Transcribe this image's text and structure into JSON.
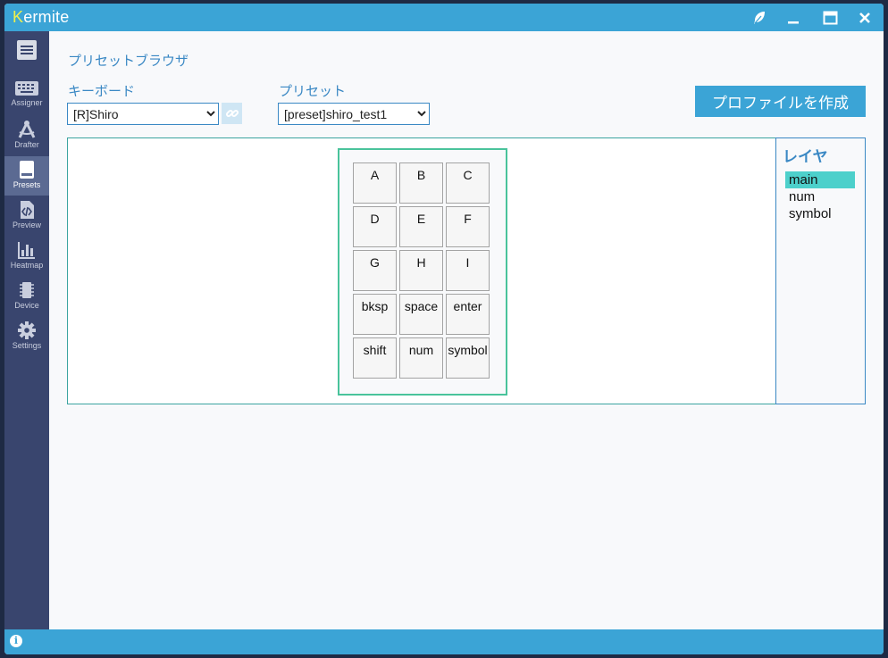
{
  "app": {
    "title_first": "K",
    "title_rest": "ermite"
  },
  "sidebar": {
    "items": [
      {
        "label": "Assigner",
        "icon": "keyboard-icon"
      },
      {
        "label": "Drafter",
        "icon": "compass-icon"
      },
      {
        "label": "Presets",
        "icon": "book-icon",
        "active": true
      },
      {
        "label": "Preview",
        "icon": "code-file-icon"
      },
      {
        "label": "Heatmap",
        "icon": "bar-chart-icon"
      },
      {
        "label": "Device",
        "icon": "chip-icon"
      },
      {
        "label": "Settings",
        "icon": "gear-icon"
      }
    ]
  },
  "page": {
    "title": "プリセットブラウザ",
    "keyboard_label": "キーボード",
    "keyboard_value": "[R]Shiro",
    "preset_label": "プリセット",
    "preset_value": "[preset]shiro_test1",
    "create_profile_button": "プロファイルを作成"
  },
  "keyboard": {
    "rows": [
      [
        "A",
        "B",
        "C"
      ],
      [
        "D",
        "E",
        "F"
      ],
      [
        "G",
        "H",
        "I"
      ],
      [
        "bksp",
        "space",
        "enter"
      ],
      [
        "shift",
        "num",
        "symbol"
      ]
    ]
  },
  "layers": {
    "title": "レイヤ",
    "items": [
      "main",
      "num",
      "symbol"
    ],
    "active": "main"
  },
  "colors": {
    "titlebar": "#3ba4d6",
    "sidebar": "#39456e",
    "accent_text": "#3a88c4",
    "active_layer": "#4dd0cb",
    "keyboard_frame": "#49c39b"
  }
}
